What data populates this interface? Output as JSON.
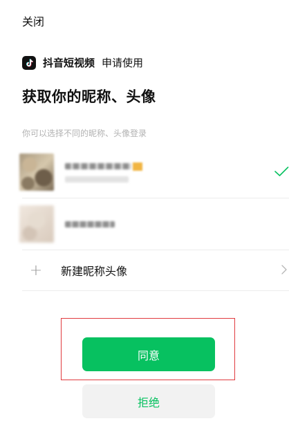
{
  "header": {
    "close_label": "关闭"
  },
  "app": {
    "name": "抖音短视频",
    "action": "申请使用",
    "logo_icon": "tiktok-logo-icon"
  },
  "title": "获取你的昵称、头像",
  "hint": "你可以选择不同的昵称、头像登录",
  "accounts": [
    {
      "selected": true
    },
    {
      "selected": false
    }
  ],
  "new_profile_label": "新建昵称头像",
  "buttons": {
    "agree": "同意",
    "reject": "拒绝"
  },
  "colors": {
    "accent": "#07c160",
    "highlight_border": "#e0393e",
    "reject_bg": "#f2f2f2"
  }
}
